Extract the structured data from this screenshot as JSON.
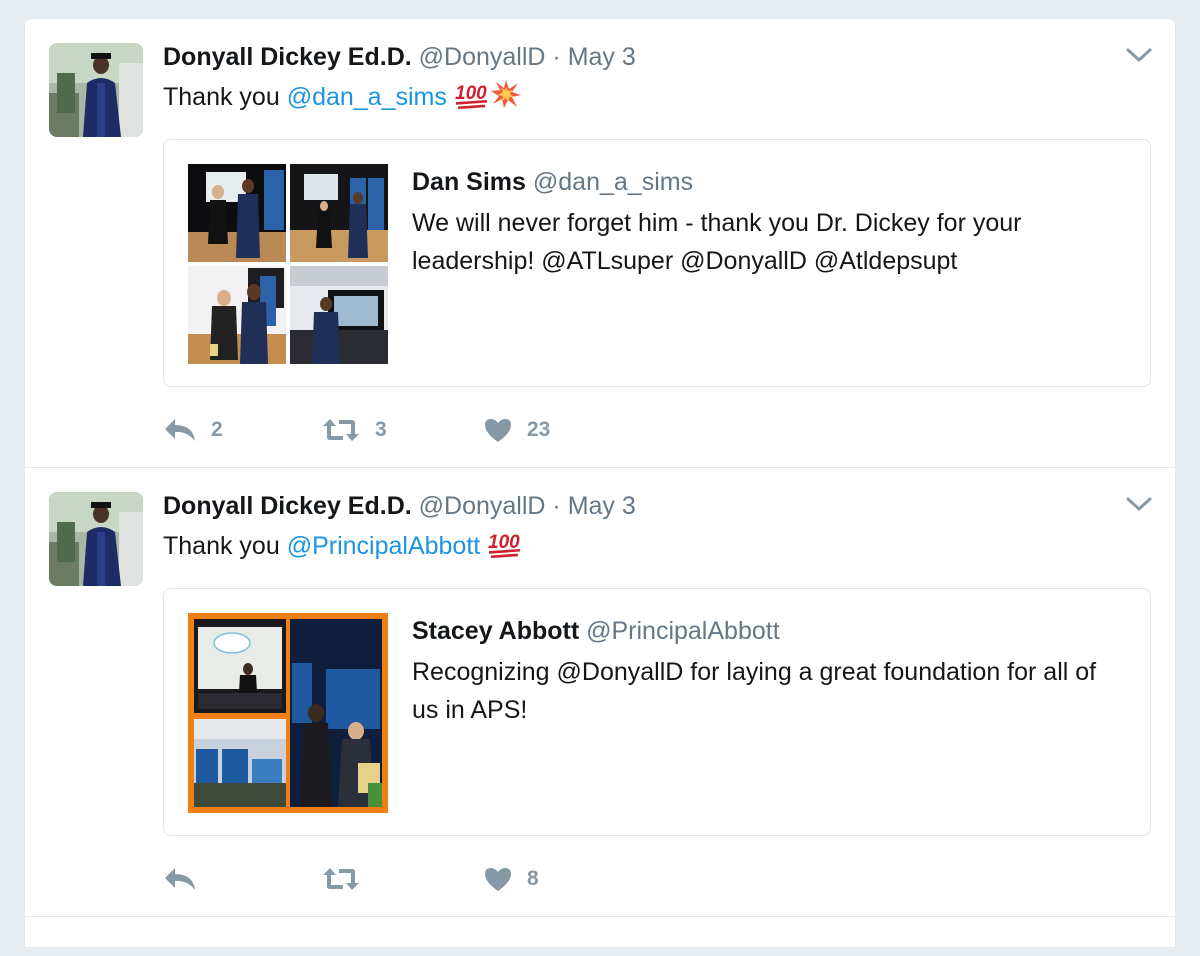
{
  "tweets": [
    {
      "fullname": "Donyall Dickey Ed.D.",
      "handle": "@DonyallD",
      "dot": "·",
      "date": "May 3",
      "text_prefix": "Thank you ",
      "mention": "@dan_a_sims",
      "emojis": [
        "hundred-points",
        "collision"
      ],
      "quote": {
        "name": "Dan Sims",
        "handle": "@dan_a_sims",
        "text": "We will never forget him  - thank you Dr. Dickey for your leadership! @ATLsuper @DonyallD @Atldepsupt"
      },
      "counts": {
        "reply": "2",
        "retweet": "3",
        "like": "23"
      }
    },
    {
      "fullname": "Donyall Dickey Ed.D.",
      "handle": "@DonyallD",
      "dot": "·",
      "date": "May 3",
      "text_prefix": "Thank you ",
      "mention": "@PrincipalAbbott",
      "emojis": [
        "hundred-points"
      ],
      "quote": {
        "name": "Stacey Abbott",
        "handle": "@PrincipalAbbott",
        "text": "Recognizing @DonyallD for laying a great foundation for all of us in APS!"
      },
      "counts": {
        "reply": "",
        "retweet": "",
        "like": "8"
      }
    }
  ],
  "icons": {
    "reply": "reply-icon",
    "retweet": "retweet-icon",
    "like": "heart-icon",
    "caret": "chevron-down-icon"
  },
  "colors": {
    "background": "#e6ecf0",
    "link": "#1b95e0",
    "secondary_text": "#657786",
    "action_gray": "#8899a6",
    "border": "#e1e8ed",
    "frame_orange": "#f07f13"
  }
}
